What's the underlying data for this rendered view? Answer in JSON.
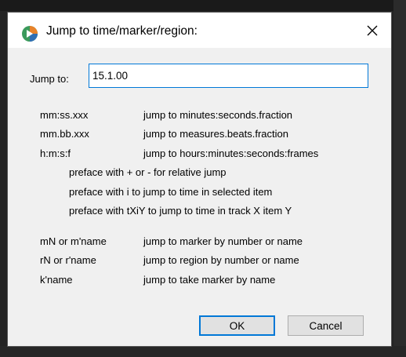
{
  "dialog": {
    "title": "Jump to time/marker/region:",
    "close_glyph": "✕",
    "jump_label": "Jump to:",
    "jump_value": "15.1.00",
    "help_rows": [
      {
        "key": "mm:ss.xxx",
        "desc": "jump to minutes:seconds.fraction"
      },
      {
        "key": "mm.bb.xxx",
        "desc": "jump to measures.beats.fraction"
      },
      {
        "key": "h:m:s:f",
        "desc": "jump to hours:minutes:seconds:frames"
      }
    ],
    "notes": [
      "preface with + or - for relative jump",
      "preface with i to jump to time in selected item",
      "preface with tXiY to jump to time in track X item Y"
    ],
    "marker_rows": [
      {
        "key": "mN or m'name",
        "desc": "jump to marker by number or name"
      },
      {
        "key": "rN or r'name",
        "desc": "jump to region by number or name"
      },
      {
        "key": "k'name",
        "desc": "jump to take marker by name"
      }
    ],
    "ok_label": "OK",
    "cancel_label": "Cancel",
    "icons": {
      "app": "reaper-logo-icon",
      "close": "close-icon"
    },
    "colors": {
      "focus": "#0078d7",
      "icon_green": "#3a9a5b",
      "icon_orange": "#e8832a",
      "icon_blue": "#2f6fb3"
    }
  }
}
